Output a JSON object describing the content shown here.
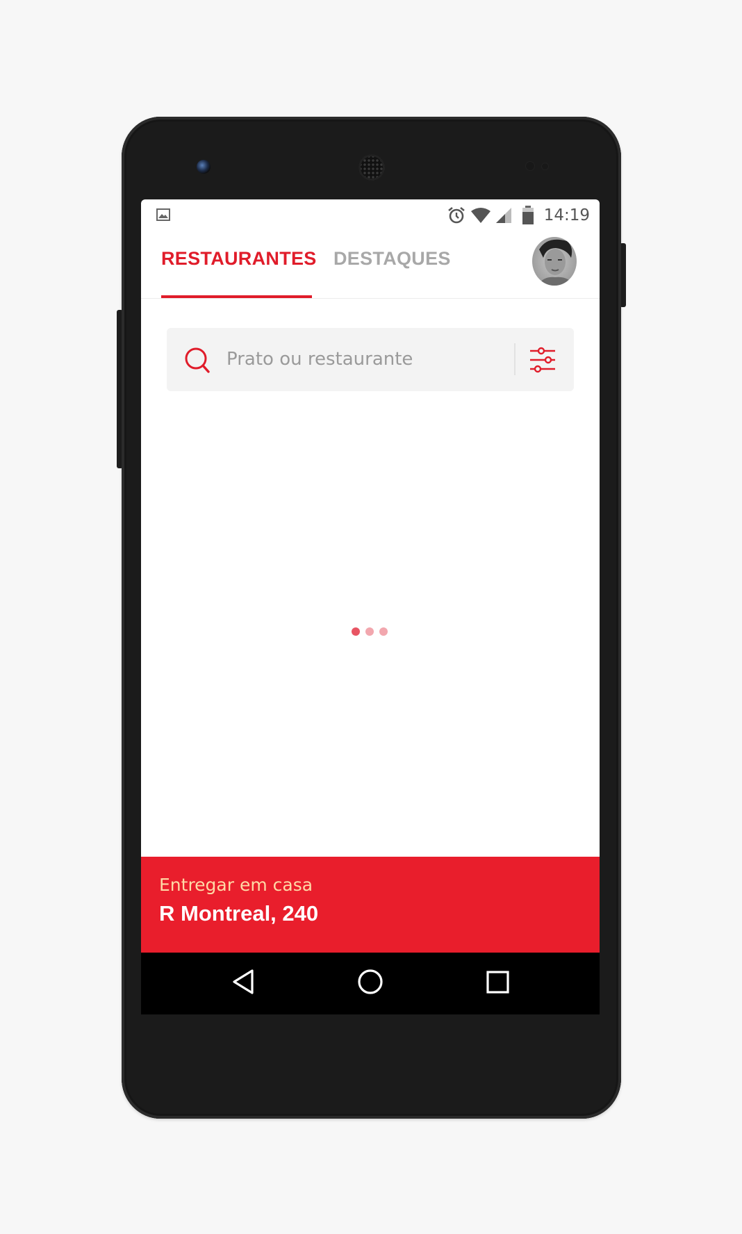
{
  "status_bar": {
    "time": "14:19",
    "icons": [
      "image-notification-icon",
      "alarm-icon",
      "wifi-icon",
      "cell-signal-icon",
      "battery-icon"
    ]
  },
  "header": {
    "tabs": [
      {
        "label": "RESTAURANTES",
        "active": true
      },
      {
        "label": "DESTAQUES",
        "active": false
      }
    ],
    "profile_icon": "avatar-photo"
  },
  "search": {
    "placeholder": "Prato ou restaurante",
    "icon": "search-icon",
    "filter_icon": "filter-sliders-icon"
  },
  "loader": {
    "icon": "loading-dots"
  },
  "delivery": {
    "label": "Entregar em casa",
    "address": "R Montreal, 240"
  },
  "nav_bar": {
    "icons": [
      "back-icon",
      "home-icon",
      "recents-icon"
    ]
  },
  "colors": {
    "accent": "#e01c2a",
    "delivery_bg": "#e91e2c",
    "delivery_label": "#ffd9a6",
    "inactive_tab": "#a8a8a8",
    "search_bg": "#f3f3f3"
  }
}
